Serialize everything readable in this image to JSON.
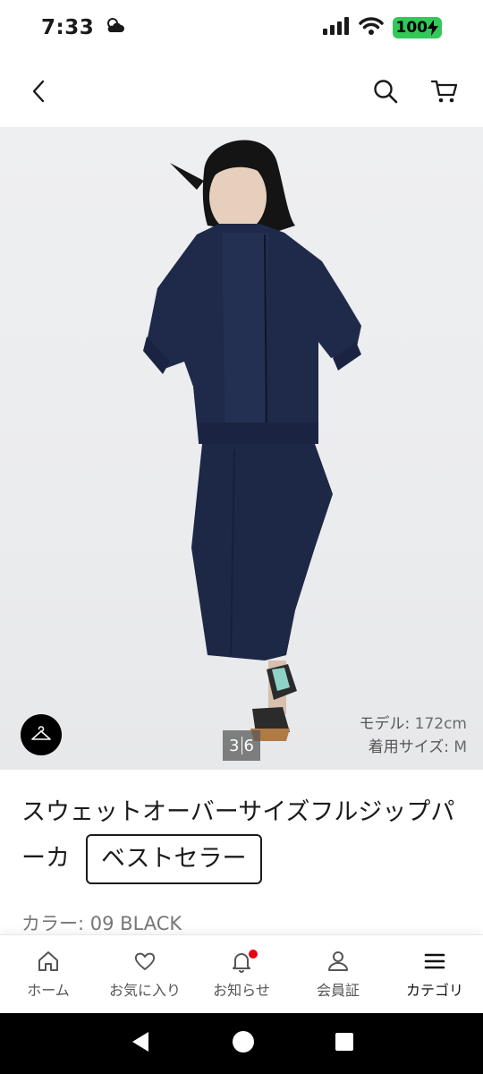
{
  "status": {
    "time": "7:33",
    "battery": "100"
  },
  "header": {
    "back_icon": "chevron-left-icon",
    "search_icon": "search-icon",
    "cart_icon": "cart-icon"
  },
  "hero": {
    "pager_current": "3",
    "pager_total": "6",
    "model_height_label": "モデル:",
    "model_height_value": "172cm",
    "model_size_label": "着用サイズ:",
    "model_size_value": "M"
  },
  "product": {
    "title": "スウェットオーバーサイズフルジップパーカ",
    "badge": "ベストセラー",
    "color_label": "カラー:",
    "color_value": "09 BLACK"
  },
  "bottom_nav": {
    "items": [
      {
        "label": "ホーム",
        "icon": "home-icon"
      },
      {
        "label": "お気に入り",
        "icon": "heart-icon"
      },
      {
        "label": "お知らせ",
        "icon": "bell-icon"
      },
      {
        "label": "会員証",
        "icon": "person-icon"
      },
      {
        "label": "カテゴリ",
        "icon": "menu-icon"
      }
    ]
  },
  "colors": {
    "accent_red": "#e60012",
    "battery_green": "#34c759",
    "garment_navy": "#1f2a4a"
  }
}
